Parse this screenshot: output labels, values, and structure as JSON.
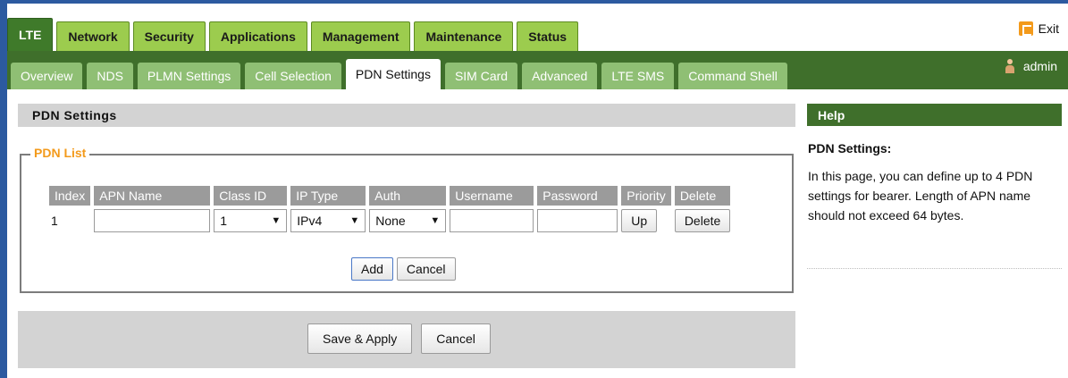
{
  "main_tabs": [
    "LTE",
    "Network",
    "Security",
    "Applications",
    "Management",
    "Maintenance",
    "Status"
  ],
  "active_main_tab": "LTE",
  "sub_tabs": [
    "Overview",
    "NDS",
    "PLMN Settings",
    "Cell Selection",
    "PDN Settings",
    "SIM Card",
    "Advanced",
    "LTE SMS",
    "Command Shell"
  ],
  "active_sub_tab": "PDN Settings",
  "header": {
    "exit_label": "Exit",
    "user_label": "admin"
  },
  "page": {
    "section_title": "PDN Settings",
    "pdn_list_legend": "PDN List",
    "table": {
      "headers": [
        "Index",
        "APN Name",
        "Class ID",
        "IP Type",
        "Auth",
        "Username",
        "Password",
        "Priority",
        "Delete"
      ],
      "rows": [
        {
          "index": "1",
          "apn_name": "",
          "class_id": "1",
          "ip_type": "IPv4",
          "auth": "None",
          "username": "",
          "password": "",
          "priority_button": "Up",
          "delete_button": "Delete"
        }
      ]
    },
    "add_button": "Add",
    "cancel_button": "Cancel",
    "save_apply_button": "Save & Apply",
    "bottom_cancel_button": "Cancel"
  },
  "help": {
    "title": "Help",
    "heading": "PDN Settings:",
    "text": "In this page, you can define up to 4 PDN settings for bearer. Length of APN name should not exceed 64 bytes."
  },
  "colors": {
    "main_tab_green": "#9ccc4e",
    "active_dark_green": "#3f6f2b",
    "subtab_green": "#8fbf74",
    "legend_orange": "#f39a1b",
    "edge_blue": "#2c5aa0"
  }
}
